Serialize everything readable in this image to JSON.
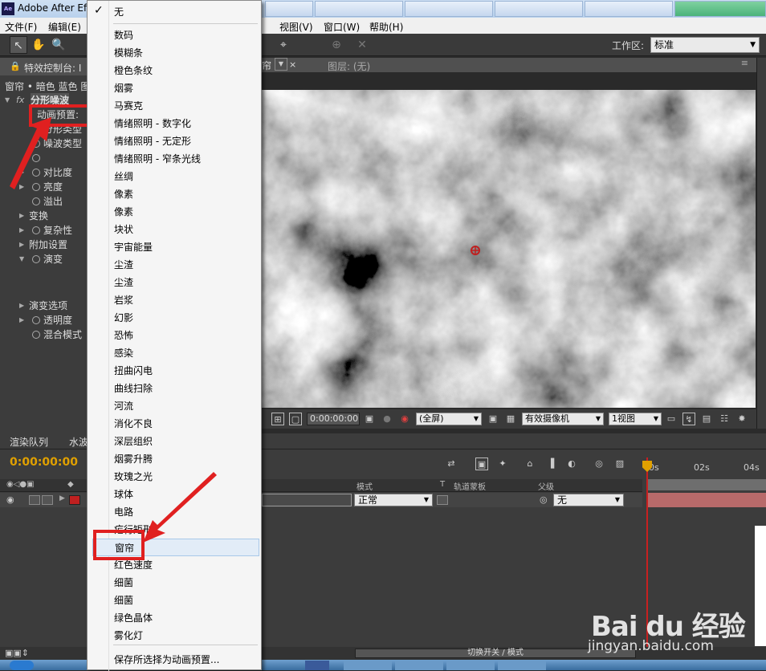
{
  "window": {
    "title": "Adobe After Ef",
    "app_icon": "Ae"
  },
  "menubar": {
    "items": [
      "文件(F)",
      "编辑(E)",
      "视图(V)",
      "窗口(W)",
      "帮助(H)"
    ]
  },
  "toolbar": {
    "workspace_label": "工作区:",
    "workspace_value": "标准"
  },
  "effect_controls": {
    "tab_label": "特效控制台: I",
    "breadcrumb": "窗帘 • 暗色 蓝色 图",
    "effect_name": "分形噪波",
    "rows": [
      {
        "label": "动画预置:",
        "highlight": true
      },
      {
        "label": "分形类型"
      },
      {
        "label": "噪波类型"
      },
      {
        "label": ""
      },
      {
        "label": "对比度"
      },
      {
        "label": "亮度"
      },
      {
        "label": "溢出"
      },
      {
        "label": "变换"
      },
      {
        "label": "复杂性"
      },
      {
        "label": "附加设置"
      },
      {
        "label": "演变"
      },
      {
        "label": "演变选项"
      },
      {
        "label": "透明度"
      },
      {
        "label": "混合模式"
      }
    ]
  },
  "composition": {
    "tab_close": "帘",
    "layer_tab": "图层: (无)",
    "timecode": "0:00:00:00",
    "resolution": "(全屏)",
    "camera": "有效摄像机",
    "views": "1视图"
  },
  "timeline": {
    "tabs": [
      "渲染队列",
      "水波"
    ],
    "timecode": "0:00:00:00",
    "columns": {
      "mode": "模式",
      "t": "T",
      "trkmat": "轨道蒙板",
      "parent": "父级"
    },
    "layer": {
      "mode": "正常",
      "parent": "无"
    },
    "ruler": [
      "0s",
      "02s",
      "04s"
    ],
    "switch_button": "切换开关 / 模式"
  },
  "preset_menu": {
    "items": [
      "无",
      "数码",
      "模糊条",
      "橙色条纹",
      "烟雾",
      "马赛克",
      "情绪照明 - 数字化",
      "情绪照明 - 无定形",
      "情绪照明 - 窄条光线",
      "丝绸",
      "像素",
      "像素",
      "块状",
      "宇宙能量",
      "尘渣",
      "尘渣",
      "岩浆",
      "幻影",
      "恐怖",
      "感染",
      "扭曲闪电",
      "曲线扫除",
      "河流",
      "消化不良",
      "深层组织",
      "烟雾升腾",
      "玫瑰之光",
      "球体",
      "电路",
      "疟行矩形",
      "窗帘",
      "红色速度",
      "细菌",
      "细菌",
      "绿色晶体",
      "雾化灯"
    ],
    "checked_index": 0,
    "highlighted_index": 30,
    "save_item": "保存所选择为动画预置..."
  },
  "watermark": {
    "brand": "Bai du 经验",
    "url": "jingyan.baidu.com"
  },
  "colors": {
    "annotation": "#e02020",
    "timecode": "#e0a000",
    "menu_highlight": "#e2ecf7"
  }
}
